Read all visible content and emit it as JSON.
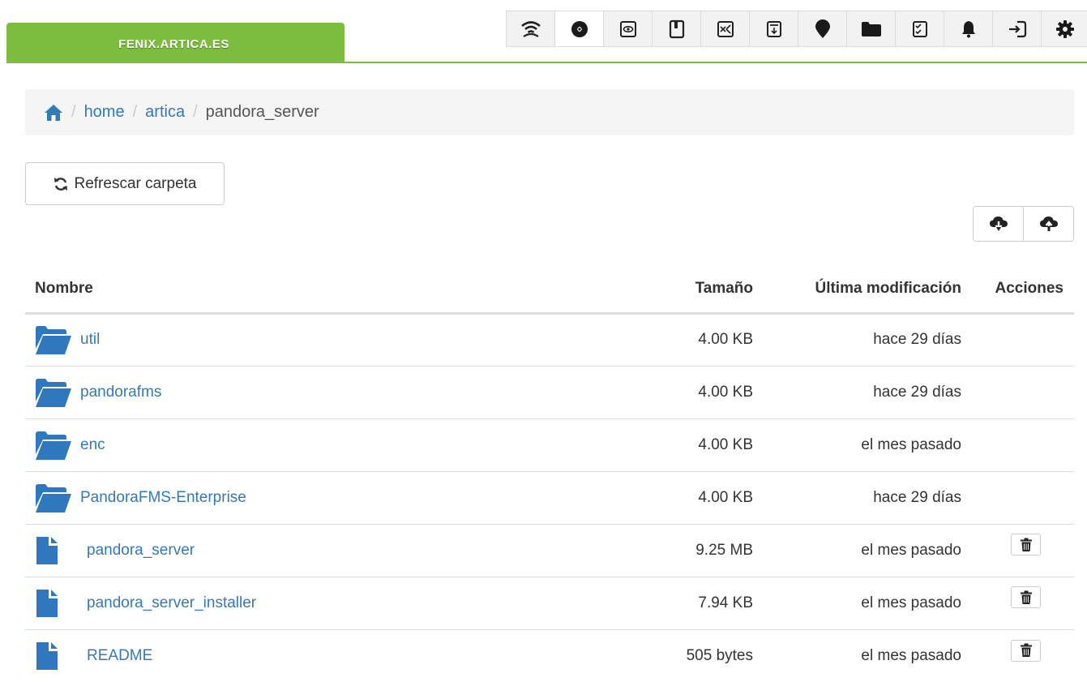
{
  "header": {
    "hostname": "FENIX.ARTICA.ES",
    "icons": [
      {
        "name": "wifi-icon",
        "active": false
      },
      {
        "name": "eye-half-icon",
        "active": true
      },
      {
        "name": "eye-icon",
        "active": false
      },
      {
        "name": "bookmark-icon",
        "active": false
      },
      {
        "name": "chart-icon",
        "active": false
      },
      {
        "name": "download-box-icon",
        "active": false
      },
      {
        "name": "map-marker-icon",
        "active": false
      },
      {
        "name": "folder-icon",
        "active": false
      },
      {
        "name": "checklist-icon",
        "active": false
      },
      {
        "name": "bell-icon",
        "active": false
      },
      {
        "name": "logout-icon",
        "active": false
      },
      {
        "name": "gear-icon",
        "active": false
      }
    ],
    "accent_color": "#7cbc3f"
  },
  "breadcrumb": {
    "home_icon": "home-icon",
    "items": [
      "home",
      "artica"
    ],
    "current": "pandora_server"
  },
  "toolbar": {
    "refresh_label": "Refrescar carpeta",
    "refresh_icon": "refresh-icon",
    "download_icon": "cloud-download-icon",
    "upload_icon": "cloud-upload-icon"
  },
  "table": {
    "headers": {
      "name": "Nombre",
      "size": "Tamaño",
      "modified": "Última modificación",
      "actions": "Acciones"
    },
    "rows": [
      {
        "type": "folder",
        "name": "util",
        "size": "4.00 KB",
        "modified": "hace 29 días"
      },
      {
        "type": "folder",
        "name": "pandorafms",
        "size": "4.00 KB",
        "modified": "hace 29 días"
      },
      {
        "type": "folder",
        "name": "enc",
        "size": "4.00 KB",
        "modified": "el mes pasado"
      },
      {
        "type": "folder",
        "name": "PandoraFMS-Enterprise",
        "size": "4.00 KB",
        "modified": "hace 29 días"
      },
      {
        "type": "file",
        "name": "pandora_server",
        "size": "9.25 MB",
        "modified": "el mes pasado"
      },
      {
        "type": "file",
        "name": "pandora_server_installer",
        "size": "7.94 KB",
        "modified": "el mes pasado"
      },
      {
        "type": "file",
        "name": "README",
        "size": "505 bytes",
        "modified": "el mes pasado"
      }
    ],
    "link_color": "#337ab7",
    "delete_icon": "trash-icon"
  }
}
